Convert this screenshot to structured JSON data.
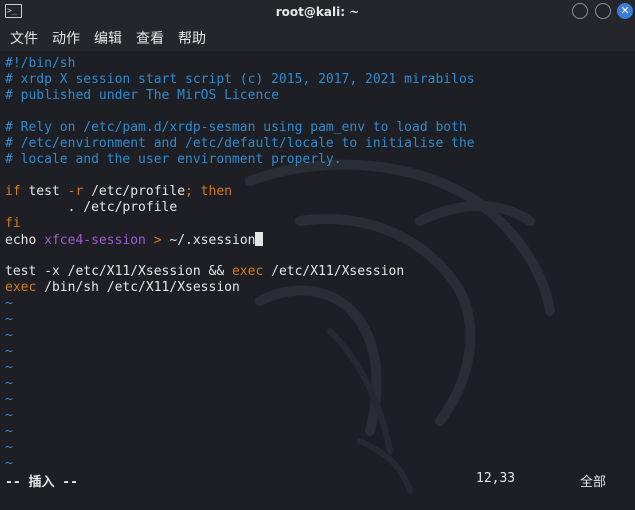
{
  "window": {
    "title": "root@kali: ~",
    "icon": "terminal-icon",
    "buttons": [
      "minimize",
      "maximize",
      "close"
    ],
    "close_glyph": "✕"
  },
  "menubar": {
    "items": [
      "文件",
      "动作",
      "编辑",
      "查看",
      "帮助"
    ]
  },
  "editor": {
    "lines": [
      [
        {
          "text": "#!/bin/sh",
          "cls": "c-comment"
        }
      ],
      [
        {
          "text": "# xrdp X session start script (c) 2015, 2017, 2021 mirabilos",
          "cls": "c-comment"
        }
      ],
      [
        {
          "text": "# published under The MirOS Licence",
          "cls": "c-comment"
        }
      ],
      [],
      [
        {
          "text": "# Rely on /etc/pam.d/xrdp-sesman using pam_env to load both",
          "cls": "c-comment"
        }
      ],
      [
        {
          "text": "# /etc/environment and /etc/default/locale to initialise the",
          "cls": "c-comment"
        }
      ],
      [
        {
          "text": "# locale and the user environment properly.",
          "cls": "c-comment"
        }
      ],
      [],
      [
        {
          "text": "if",
          "cls": "c-keyword"
        },
        {
          "text": " test ",
          "cls": ""
        },
        {
          "text": "-r",
          "cls": "c-keyword"
        },
        {
          "text": " /etc/profile",
          "cls": ""
        },
        {
          "text": "; then",
          "cls": "c-keyword"
        }
      ],
      [
        {
          "text": "        . /etc/profile",
          "cls": ""
        }
      ],
      [
        {
          "text": "fi",
          "cls": "c-keyword"
        }
      ],
      [
        {
          "text": "echo ",
          "cls": ""
        },
        {
          "text": "xfce4-session",
          "cls": "c-purple"
        },
        {
          "text": " > ",
          "cls": "c-keyword"
        },
        {
          "text": "~/.xsession",
          "cls": ""
        },
        {
          "cursor": true
        }
      ],
      [],
      [
        {
          "text": "test -x /etc/X11/Xsession && ",
          "cls": ""
        },
        {
          "text": "exec",
          "cls": "c-keyword"
        },
        {
          "text": " /etc/X11/Xsession",
          "cls": ""
        }
      ],
      [
        {
          "text": "exec",
          "cls": "c-keyword"
        },
        {
          "text": " /bin/sh /etc/X11/Xsession",
          "cls": ""
        }
      ],
      [
        {
          "text": "~",
          "cls": "c-tilde"
        }
      ],
      [
        {
          "text": "~",
          "cls": "c-tilde"
        }
      ],
      [
        {
          "text": "~",
          "cls": "c-tilde"
        }
      ],
      [
        {
          "text": "~",
          "cls": "c-tilde"
        }
      ],
      [
        {
          "text": "~",
          "cls": "c-tilde"
        }
      ],
      [
        {
          "text": "~",
          "cls": "c-tilde"
        }
      ],
      [
        {
          "text": "~",
          "cls": "c-tilde"
        }
      ],
      [
        {
          "text": "~",
          "cls": "c-tilde"
        }
      ],
      [
        {
          "text": "~",
          "cls": "c-tilde"
        }
      ],
      [
        {
          "text": "~",
          "cls": "c-tilde"
        }
      ],
      [
        {
          "text": "~",
          "cls": "c-tilde"
        }
      ]
    ]
  },
  "statusbar": {
    "mode": "-- 插入 --",
    "position": "12,33",
    "scroll": "全部"
  },
  "colors": {
    "background": "#1d1f24",
    "titlebar": "#24262b",
    "comment": "#2f8bcf",
    "keyword": "#d47a1e",
    "string_purple": "#a05ad1",
    "text": "#e6e6e6",
    "close_button": "#3c7dd6"
  }
}
